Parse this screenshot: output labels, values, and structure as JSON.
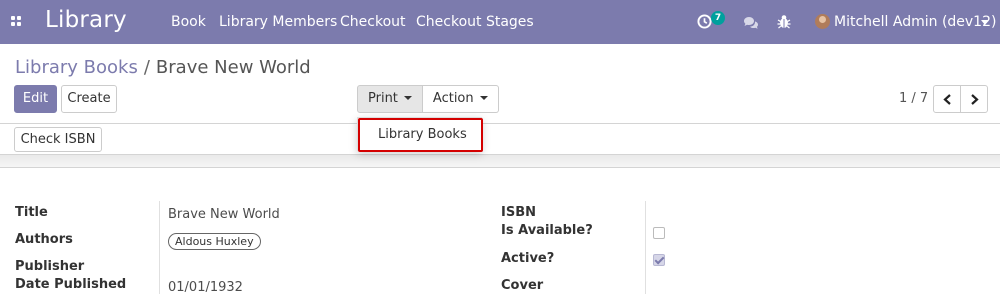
{
  "navbar": {
    "brand": "Library",
    "menu": [
      "Book",
      "Library Members",
      "Checkout",
      "Checkout Stages"
    ],
    "activity_count": "7",
    "user": "Mitchell Admin (dev12)",
    "bg_color": "#7c7bad"
  },
  "breadcrumb": {
    "parent": "Library Books",
    "separator": "/",
    "current": "Brave New World"
  },
  "buttons": {
    "edit": "Edit",
    "create": "Create",
    "print": "Print",
    "action": "Action",
    "check_isbn": "Check ISBN"
  },
  "pager": {
    "value": "1 / 7"
  },
  "print_menu": {
    "items": [
      "Library Books"
    ]
  },
  "form": {
    "left": {
      "title_label": "Title",
      "title_value": "Brave New World",
      "authors_label": "Authors",
      "authors": [
        "Aldous Huxley"
      ],
      "publisher_label": "Publisher",
      "date_label": "Date Published",
      "date_value": "01/01/1932"
    },
    "right": {
      "isbn_label": "ISBN",
      "available_label": "Is Available?",
      "available": false,
      "active_label": "Active?",
      "active": true,
      "cover_label": "Cover"
    }
  },
  "icons": {
    "apps": "apps-grid-icon",
    "activity": "clock-icon",
    "messages": "chat-icon",
    "debug": "bug-icon",
    "pager_prev": "chevron-left-icon",
    "pager_next": "chevron-right-icon"
  }
}
